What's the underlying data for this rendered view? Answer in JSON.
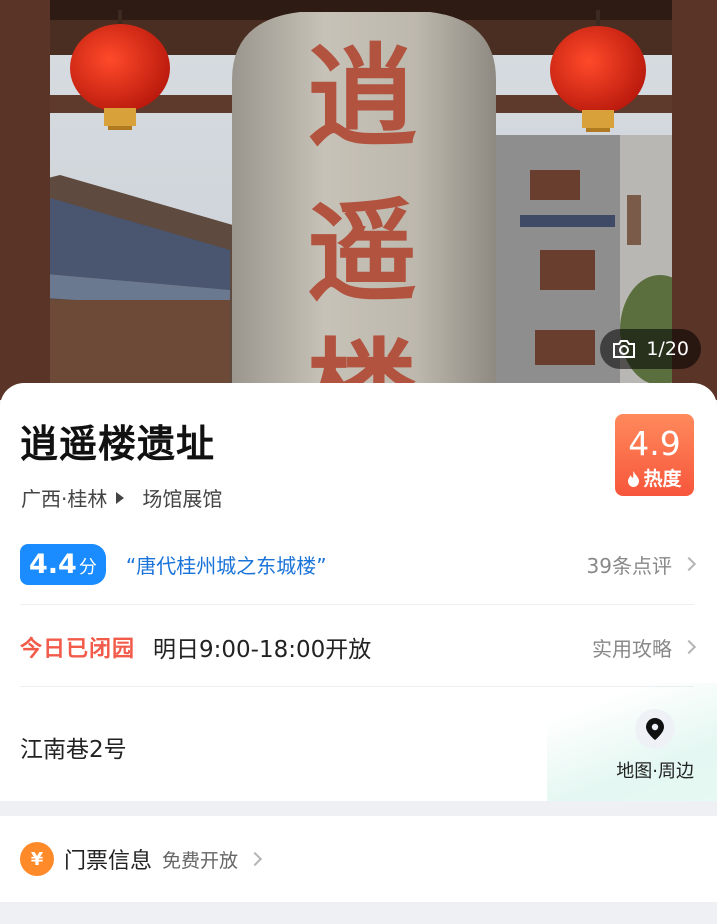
{
  "hero": {
    "photo_counter": "1/20",
    "stele_text": [
      "逍",
      "遥",
      "楼"
    ]
  },
  "place": {
    "title": "逍遥楼遗址",
    "region": "广西·桂林",
    "category": "场馆展馆"
  },
  "heat": {
    "score": "4.9",
    "label": "热度",
    "color": "#f7563b"
  },
  "rating": {
    "score": "4.4",
    "unit": "分",
    "quote": "“唐代桂州城之东城楼”",
    "reviews": "39条点评",
    "color": "#1a8cff"
  },
  "hours": {
    "status": "今日已闭园",
    "next_open": "明日9:00-18:00开放",
    "guide_link": "实用攻略",
    "status_color": "#f25a4a"
  },
  "address": {
    "text": "江南巷2号",
    "map_label": "地图·周边",
    "icon": "map-pin-icon"
  },
  "ticket": {
    "icon_glyph": "¥",
    "label": "门票信息",
    "sub": "免费开放"
  }
}
